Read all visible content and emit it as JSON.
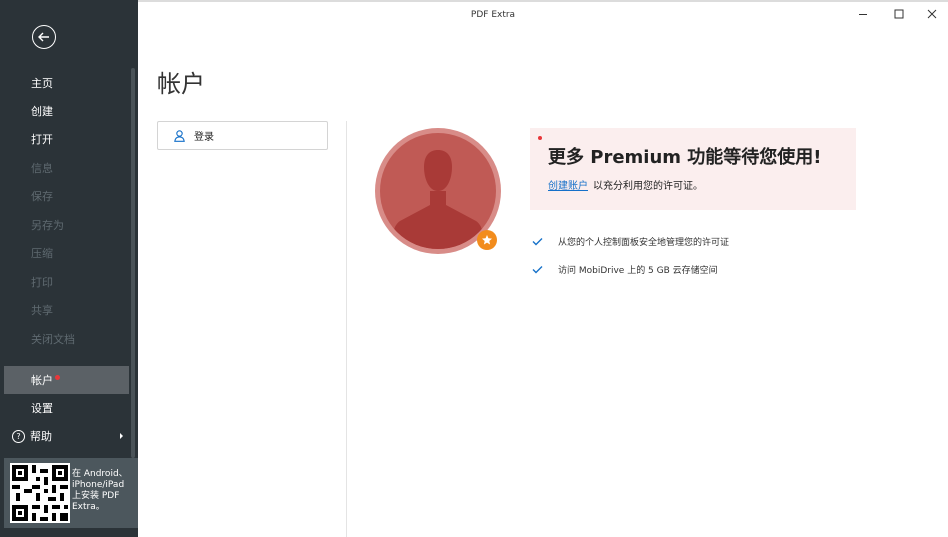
{
  "window": {
    "title": "PDF Extra",
    "minimize_icon": "minimize-icon",
    "maximize_icon": "maximize-icon",
    "close_icon": "close-icon"
  },
  "sidebar": {
    "back_icon": "arrow-left-icon",
    "items": [
      {
        "label": "主页",
        "enabled": true
      },
      {
        "label": "创建",
        "enabled": true
      },
      {
        "label": "打开",
        "enabled": true
      },
      {
        "label": "信息",
        "enabled": false
      },
      {
        "label": "保存",
        "enabled": false
      },
      {
        "label": "另存为",
        "enabled": false
      },
      {
        "label": "压缩",
        "enabled": false
      },
      {
        "label": "打印",
        "enabled": false
      },
      {
        "label": "共享",
        "enabled": false
      },
      {
        "label": "关闭文档",
        "enabled": false
      }
    ],
    "account_label": "帐户",
    "settings_label": "设置",
    "help_label": "帮助",
    "help_icon_text": "?",
    "promo_text": "在 Android、iPhone/iPad 上安装 PDF Extra。",
    "colors": {
      "background": "#2b3338",
      "active": "#5b6166",
      "disabled_text": "#5f6a70",
      "notification_dot": "#e8373a"
    }
  },
  "main": {
    "title": "帐户",
    "login_label": "登录",
    "banner": {
      "title": "更多 Premium 功能等待您使用!",
      "link_text": "创建账户",
      "after_link_text": "以充分利用您的许可证。",
      "background": "#fbeeee",
      "link_color": "#1570c9"
    },
    "features": [
      "从您的个人控制面板安全地管理您的许可证",
      "访问 MobiDrive 上的 5 GB 云存储空间"
    ],
    "avatar": {
      "color": "#c05a55",
      "badge_color": "#f28c1d",
      "badge_icon": "star-icon"
    }
  }
}
